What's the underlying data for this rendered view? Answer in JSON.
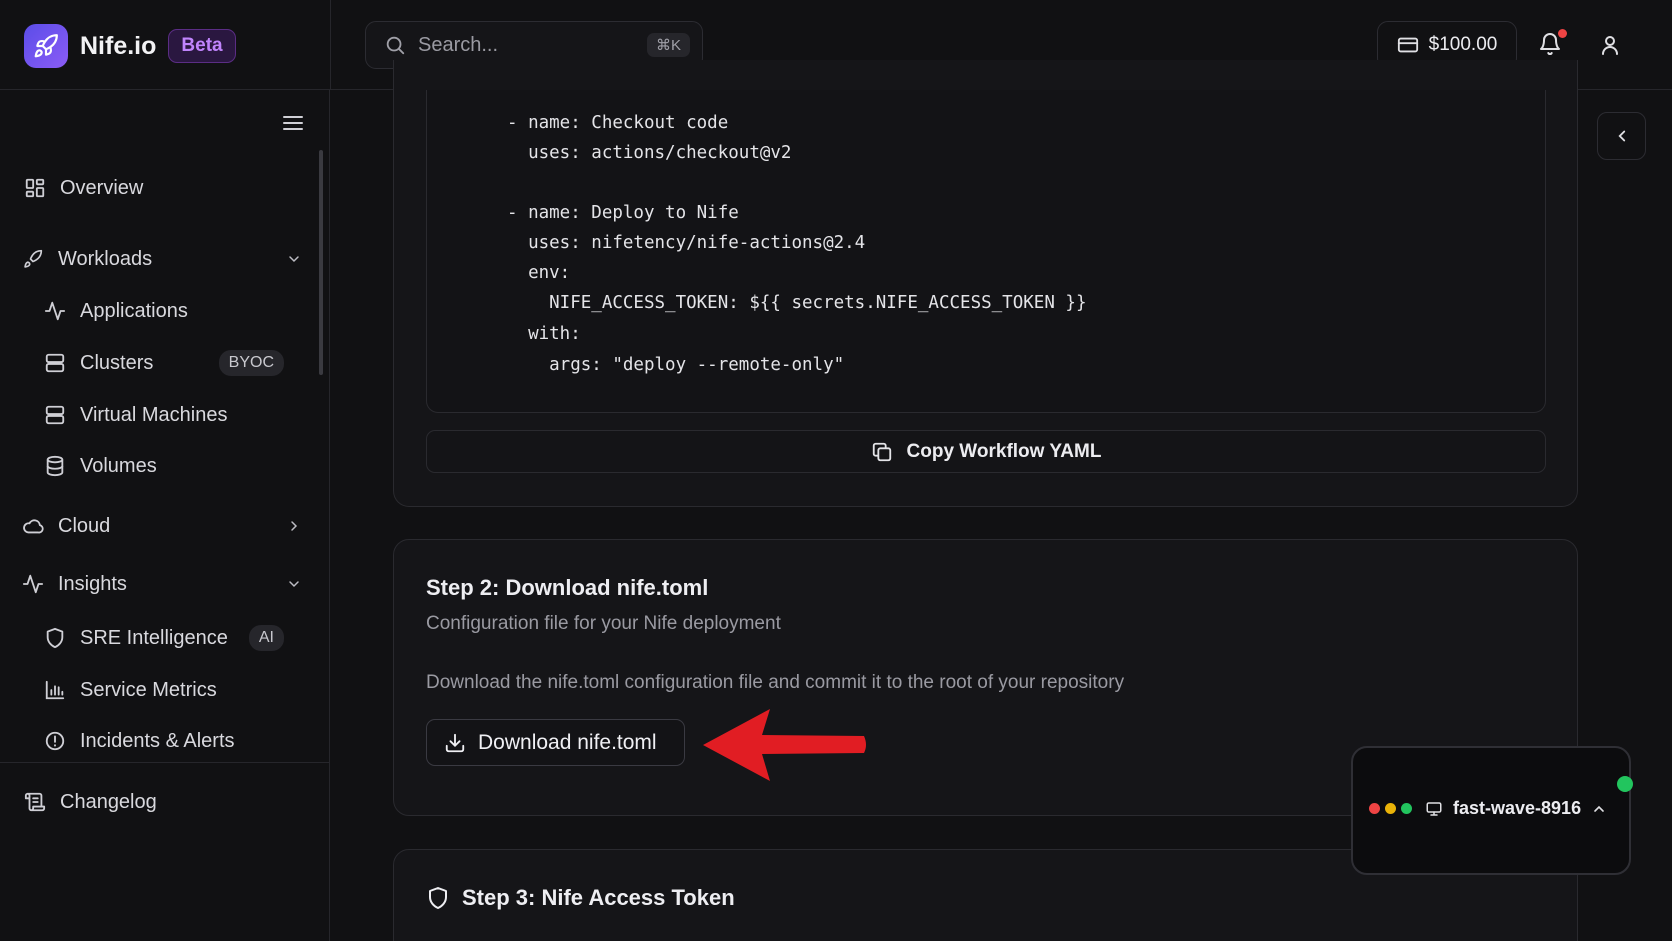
{
  "brand": {
    "name": "Nife.io",
    "badge": "Beta"
  },
  "search": {
    "placeholder": "Search...",
    "shortcut": "⌘K"
  },
  "header": {
    "balance": "$100.00"
  },
  "sidebar": {
    "overview": "Overview",
    "workloads": "Workloads",
    "applications": "Applications",
    "clusters": "Clusters",
    "clusters_tag": "BYOC",
    "virtual_machines": "Virtual Machines",
    "volumes": "Volumes",
    "cloud": "Cloud",
    "insights": "Insights",
    "sre": "SRE Intelligence",
    "sre_tag": "AI",
    "service_metrics": "Service Metrics",
    "incidents": "Incidents & Alerts",
    "changelog": "Changelog"
  },
  "workflow": {
    "code_lines": [
      "- name: Checkout code",
      "  uses: actions/checkout@v2",
      "- name: Deploy to Nife",
      "  uses: nifetency/nife-actions@2.4",
      "  env:",
      "    NIFE_ACCESS_TOKEN: ${{ secrets.NIFE_ACCESS_TOKEN }}",
      "  with:",
      "    args: \"deploy --remote-only\""
    ],
    "copy_label": "Copy Workflow YAML"
  },
  "step2": {
    "title": "Step 2: Download nife.toml",
    "subtitle": "Configuration file for your Nife deployment",
    "description": "Download the nife.toml configuration file and commit it to the root of your repository",
    "download_label": "Download nife.toml"
  },
  "step3": {
    "title": "Step 3: Nife Access Token"
  },
  "widget": {
    "name": "fast-wave-8916"
  },
  "colors": {
    "accent": "#8b5cf6",
    "beta": "#c084fc",
    "arrow": "#e11d23",
    "online": "#22c55e"
  }
}
